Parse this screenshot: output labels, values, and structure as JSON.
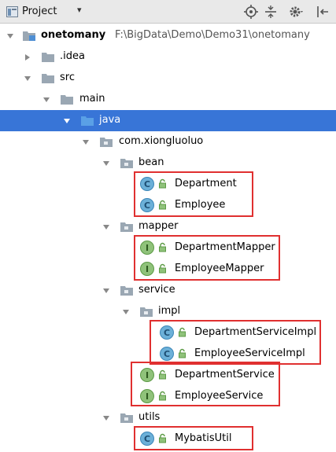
{
  "header": {
    "title": "Project",
    "dropdown_icon": "chevron-down-icon",
    "buttons": [
      "locate-icon",
      "collapse-all-icon",
      "gear-icon",
      "hide-panel-icon"
    ]
  },
  "tree": {
    "root": {
      "label": "onetomany",
      "path": "F:\\BigData\\Demo\\Demo31\\onetomany"
    },
    "idea": "idea",
    "src": "src",
    "main": "main",
    "java": "java",
    "package": "com.xiongluoluo",
    "bean": {
      "label": "bean",
      "classes": [
        "Department",
        "Employee"
      ]
    },
    "mapper": {
      "label": "mapper",
      "interfaces": [
        "DepartmentMapper",
        "EmployeeMapper"
      ]
    },
    "service": {
      "label": "service",
      "impl": {
        "label": "impl",
        "classes": [
          "DepartmentServiceImpl",
          "EmployeeServiceImpl"
        ]
      },
      "interfaces": [
        "DepartmentService",
        "EmployeeService"
      ]
    },
    "utils": {
      "label": "utils",
      "classes": [
        "MybatisUtil"
      ]
    }
  },
  "colors": {
    "selection": "#3875d7",
    "highlight_box": "#e03030",
    "class_badge": "#6cb0d8",
    "interface_badge": "#8fc27a",
    "folder": "#9aa7b3",
    "source_folder": "#4f8fd4"
  }
}
